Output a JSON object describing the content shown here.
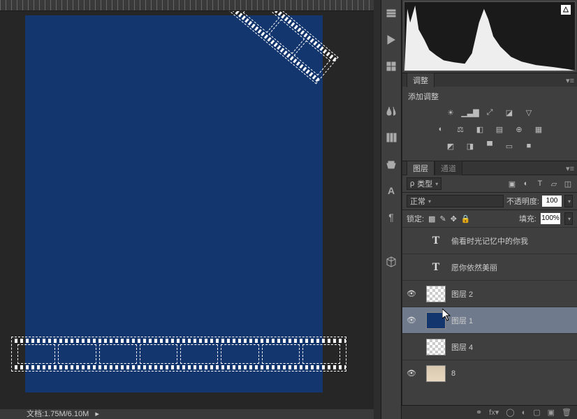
{
  "status_text": "文档:1.75M/6.10M",
  "adjustments": {
    "tab": "调整",
    "title": "添加调整"
  },
  "layers_panel": {
    "tab1": "图层",
    "tab2": "通道",
    "kind_label": "类型",
    "blend_mode": "正常",
    "opacity_label": "不透明度:",
    "opacity_value": "100",
    "lock_label": "锁定:",
    "fill_label": "填充:",
    "fill_value": "100%"
  },
  "layers": [
    {
      "name": "偷看时光记忆中的你我",
      "type": "text",
      "visible": false
    },
    {
      "name": "愿你依然美丽",
      "type": "text",
      "visible": false
    },
    {
      "name": "图层 2",
      "type": "raster",
      "thumb": "checker",
      "visible": true
    },
    {
      "name": "图层 1",
      "type": "raster",
      "thumb": "blue",
      "visible": true,
      "selected": true
    },
    {
      "name": "图层 4",
      "type": "raster",
      "thumb": "checker",
      "visible": false
    },
    {
      "name": "8",
      "type": "raster",
      "thumb": "img",
      "visible": true
    }
  ]
}
